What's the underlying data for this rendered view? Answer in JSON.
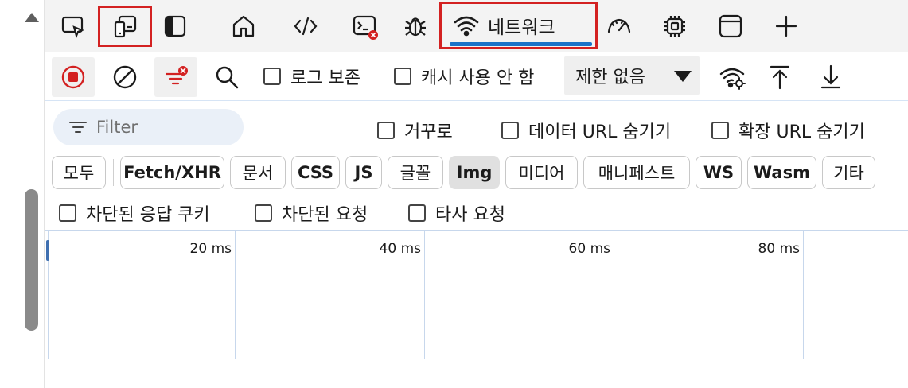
{
  "tabs": {
    "network_label": "네트워크"
  },
  "toolbar": {
    "preserve_log": "로그 보존",
    "disable_cache": "캐시 사용 안 함",
    "throttle": "제한 없음"
  },
  "filter": {
    "placeholder": "Filter",
    "invert": "거꾸로",
    "hide_data_urls": "데이터 URL 숨기기",
    "hide_extension_urls": "확장 URL 숨기기"
  },
  "types": [
    {
      "label": "모두",
      "bold": false,
      "active": false
    },
    {
      "label": "Fetch/XHR",
      "bold": true,
      "active": false
    },
    {
      "label": "문서",
      "bold": false,
      "active": false
    },
    {
      "label": "CSS",
      "bold": true,
      "active": false
    },
    {
      "label": "JS",
      "bold": true,
      "active": false
    },
    {
      "label": "글꼴",
      "bold": false,
      "active": false
    },
    {
      "label": "Img",
      "bold": true,
      "active": true
    },
    {
      "label": "미디어",
      "bold": false,
      "active": false
    },
    {
      "label": "매니페스트",
      "bold": false,
      "active": false
    },
    {
      "label": "WS",
      "bold": true,
      "active": false
    },
    {
      "label": "Wasm",
      "bold": true,
      "active": false
    },
    {
      "label": "기타",
      "bold": false,
      "active": false
    }
  ],
  "extra_filters": {
    "blocked_cookies": "차단된 응답 쿠키",
    "blocked_requests": "차단된 요청",
    "third_party": "타사 요청"
  },
  "timeline": {
    "ticks": [
      "20 ms",
      "40 ms",
      "60 ms",
      "80 ms"
    ]
  },
  "icons": {
    "inspect": "inspect-element-icon",
    "device": "device-emulation-icon",
    "dock": "dock-panel-icon",
    "welcome": "home-icon",
    "elements": "code-icon",
    "console": "console-icon",
    "sources": "bug-icon",
    "network": "wifi-icon",
    "performance": "gauge-icon",
    "memory": "chip-icon",
    "application": "window-icon",
    "more": "plus-icon"
  },
  "colors": {
    "highlight": "#d32121",
    "active_tab_underline": "#1a73c9",
    "record": "#d32121"
  }
}
